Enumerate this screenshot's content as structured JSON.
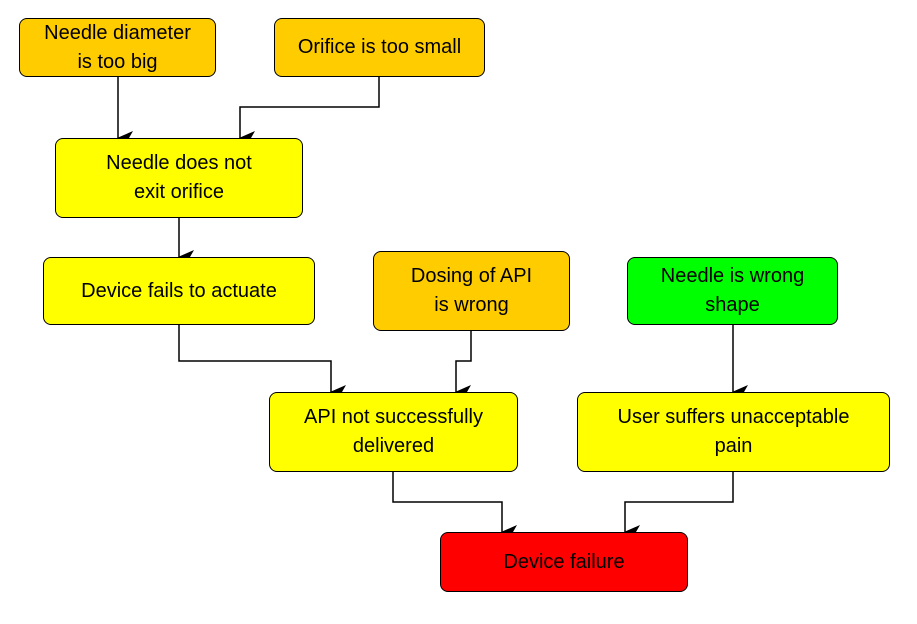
{
  "diagram": {
    "type": "fault-tree-flowchart",
    "colors": {
      "root_cause": "#FFCC00",
      "intermediate": "#FFFF00",
      "independent_cause": "#00FF00",
      "top_event": "#FF0000",
      "stroke": "#000000"
    },
    "nodes": [
      {
        "id": "n1",
        "label": "Needle diameter\nis too big",
        "category": "root_cause"
      },
      {
        "id": "n2",
        "label": "Orifice is too small",
        "category": "root_cause"
      },
      {
        "id": "n3",
        "label": "Needle does not\nexit orifice",
        "category": "intermediate"
      },
      {
        "id": "n4",
        "label": "Device fails to actuate",
        "category": "intermediate"
      },
      {
        "id": "n5",
        "label": "Dosing of API\nis wrong",
        "category": "root_cause"
      },
      {
        "id": "n6",
        "label": "Needle is wrong\nshape",
        "category": "independent_cause"
      },
      {
        "id": "n7",
        "label": "API not successfully\ndelivered",
        "category": "intermediate"
      },
      {
        "id": "n8",
        "label": "User suffers unacceptable\npain",
        "category": "intermediate"
      },
      {
        "id": "n9",
        "label": "Device failure",
        "category": "top_event"
      }
    ],
    "edges": [
      {
        "from": "n1",
        "to": "n3"
      },
      {
        "from": "n2",
        "to": "n3"
      },
      {
        "from": "n3",
        "to": "n4"
      },
      {
        "from": "n4",
        "to": "n7"
      },
      {
        "from": "n5",
        "to": "n7"
      },
      {
        "from": "n6",
        "to": "n8"
      },
      {
        "from": "n7",
        "to": "n9"
      },
      {
        "from": "n8",
        "to": "n9"
      }
    ]
  }
}
